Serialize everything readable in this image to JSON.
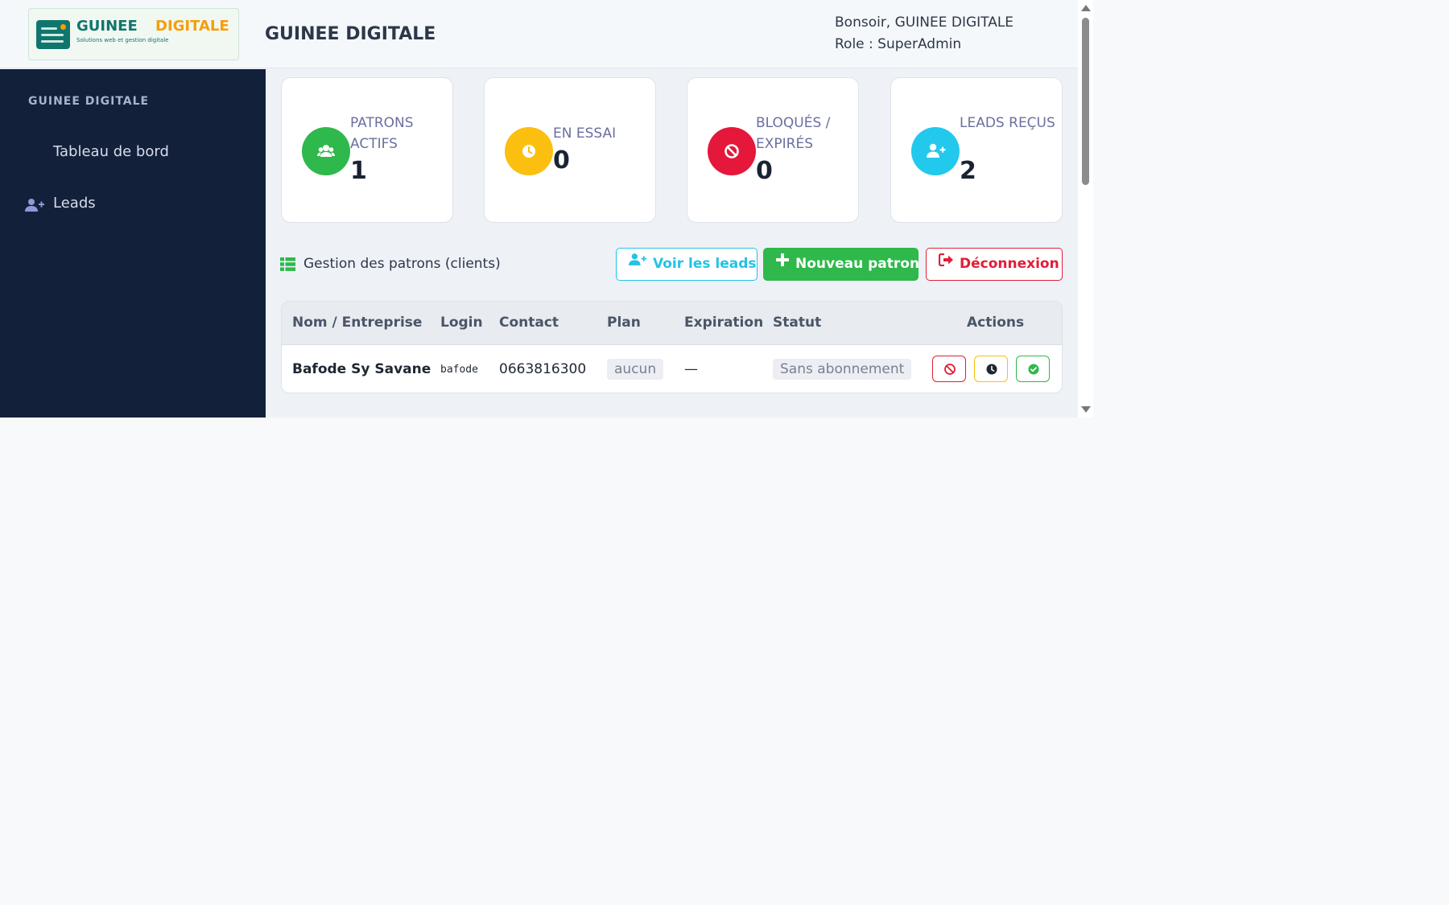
{
  "header": {
    "logo": {
      "word1": "GUINEE",
      "word2": "DIGITALE",
      "tagline": "Solutions web et gestion digitale"
    },
    "title": "GUINEE DIGITALE",
    "greeting": "Bonsoir, GUINEE DIGITALE",
    "role": "Role : SuperAdmin"
  },
  "sidebar": {
    "brand": "GUINEE DIGITALE",
    "items": [
      {
        "label": "Tableau de bord",
        "icon": ""
      },
      {
        "label": "Leads",
        "icon": "user-plus-icon"
      }
    ]
  },
  "stats": [
    {
      "label": "PATRONS ACTIFS",
      "value": "1",
      "color": "#2fb84b",
      "icon": "users-icon"
    },
    {
      "label": "EN ESSAI",
      "value": "0",
      "color": "#fbbf0f",
      "icon": "clock-icon"
    },
    {
      "label": "BLOQUÉS / EXPIRÉS",
      "value": "0",
      "color": "#e5173a",
      "icon": "ban-icon"
    },
    {
      "label": "LEADS REÇUS",
      "value": "2",
      "color": "#22c9ec",
      "icon": "user-plus-icon"
    }
  ],
  "section": {
    "title": "Gestion des patrons (clients)",
    "icon": "table-list-icon"
  },
  "buttons": {
    "leads": "Voir les leads",
    "new": "Nouveau patron",
    "logout": "Déconnexion"
  },
  "table": {
    "columns": [
      "Nom / Entreprise",
      "Login",
      "Contact",
      "Plan",
      "Expiration",
      "Statut",
      "Actions"
    ],
    "rows": [
      {
        "name": "Bafode Sy Savane",
        "login": "bafode",
        "contact": "0663816300",
        "plan": "aucun",
        "expiration": "—",
        "status": "Sans abonnement",
        "actions": [
          "block-icon",
          "clock-icon",
          "check-circle-icon"
        ]
      }
    ]
  },
  "colors": {
    "sidebar_bg": "#13203a",
    "success": "#2fb84b",
    "warning": "#fbbf0f",
    "danger": "#e11d36",
    "info": "#22c3e6"
  }
}
